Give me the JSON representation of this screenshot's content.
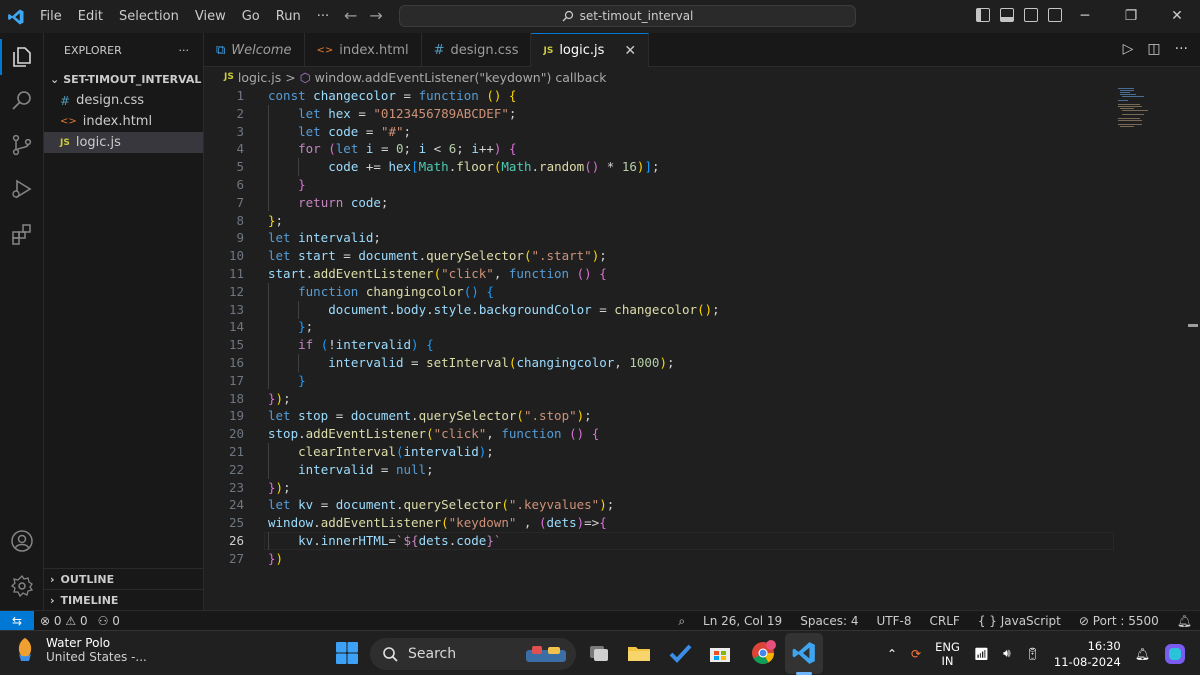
{
  "menu": [
    "File",
    "Edit",
    "Selection",
    "View",
    "Go",
    "Run",
    "···"
  ],
  "command_center": "set-timout_interval",
  "explorer": {
    "title": "EXPLORER",
    "more": "···",
    "folder": "SET-TIMOUT_INTERVAL",
    "files": [
      {
        "icon": "#",
        "name": "design.css",
        "color": "#519aba"
      },
      {
        "icon": "<>",
        "name": "index.html",
        "color": "#e37933"
      },
      {
        "icon": "JS",
        "name": "logic.js",
        "color": "#cbcb41"
      }
    ],
    "outline": "OUTLINE",
    "timeline": "TIMELINE"
  },
  "tabs": [
    {
      "icon": "⧉",
      "label": "Welcome",
      "italic": true
    },
    {
      "icon": "<>",
      "label": "index.html"
    },
    {
      "icon": "#",
      "label": "design.css"
    },
    {
      "icon": "JS",
      "label": "logic.js",
      "active": true
    }
  ],
  "breadcrumb": {
    "file_icon": "JS",
    "file": "logic.js",
    "separator": ">",
    "symbol": "window.addEventListener(\"keydown\") callback"
  },
  "editor": {
    "current_line": 26,
    "lines": [
      "const changecolor = function () {",
      "    let hex = \"0123456789ABCDEF\";",
      "    let code = \"#\";",
      "    for (let i = 0; i < 6; i++) {",
      "        code += hex[Math.floor(Math.random() * 16)];",
      "    }",
      "    return code;",
      "};",
      "let intervalid;",
      "let start = document.querySelector(\".start\");",
      "start.addEventListener(\"click\", function () {",
      "    function changingcolor() {",
      "        document.body.style.backgroundColor = changecolor();",
      "    };",
      "    if (!intervalid) {",
      "        intervalid = setInterval(changingcolor, 1000);",
      "    }",
      "});",
      "let stop = document.querySelector(\".stop\");",
      "stop.addEventListener(\"click\", function () {",
      "    clearInterval(intervalid);",
      "    intervalid = null;",
      "});",
      "let kv = document.querySelector(\".keyvalues\");",
      "window.addEventListener(\"keydown\" , (dets)=>{",
      "    kv.innerHTML=`${dets.code}`",
      "})"
    ]
  },
  "status": {
    "remote": "⇆",
    "errors": "0",
    "warnings": "0",
    "ports": "0",
    "position": "Ln 26, Col 19",
    "spaces": "Spaces: 4",
    "encoding": "UTF-8",
    "eol": "CRLF",
    "language": "{ } JavaScript",
    "port": "Port : 5500"
  },
  "taskbar": {
    "weather_title": "Water Polo",
    "weather_sub": "United States -...",
    "search": "Search",
    "lang_top": "ENG",
    "lang_bottom": "IN",
    "time": "16:30",
    "date": "11-08-2024"
  },
  "colors": {
    "accent": "#0078d4",
    "editor_bg": "#1f1f1f",
    "sidebar_bg": "#181818"
  }
}
